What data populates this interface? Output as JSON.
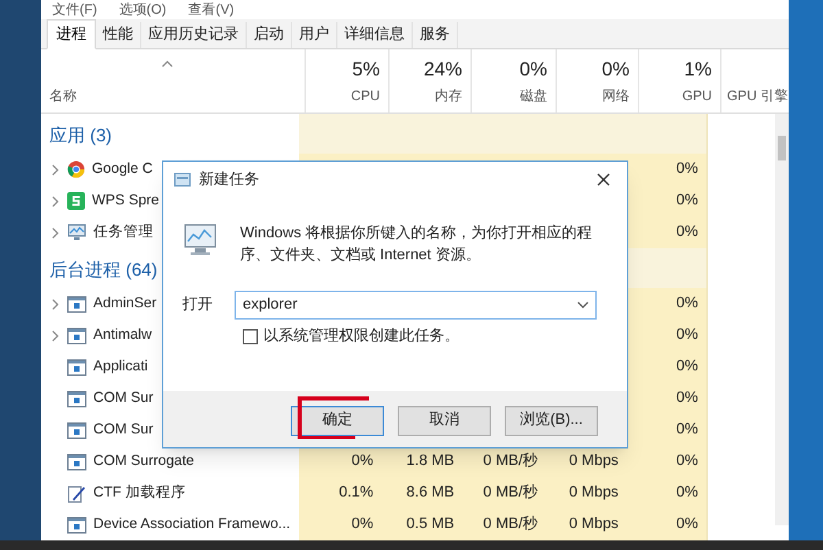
{
  "menu": [
    "文件(F)",
    "选项(O)",
    "查看(V)"
  ],
  "tabs": [
    {
      "label": "进程",
      "selected": true
    },
    {
      "label": "性能",
      "selected": false
    },
    {
      "label": "应用历史记录",
      "selected": false
    },
    {
      "label": "启动",
      "selected": false
    },
    {
      "label": "用户",
      "selected": false
    },
    {
      "label": "详细信息",
      "selected": false
    },
    {
      "label": "服务",
      "selected": false
    }
  ],
  "columns": [
    {
      "label": "名称"
    },
    {
      "value": "5%",
      "label": "CPU"
    },
    {
      "value": "24%",
      "label": "内存"
    },
    {
      "value": "0%",
      "label": "磁盘"
    },
    {
      "value": "0%",
      "label": "网络"
    },
    {
      "value": "1%",
      "label": "GPU"
    },
    {
      "label": "GPU 引擎"
    }
  ],
  "rows": [
    {
      "kind": "group",
      "name": "应用 (3)"
    },
    {
      "kind": "process",
      "expandable": true,
      "name": "Google C",
      "cells": [
        "",
        "",
        "",
        "",
        "0%"
      ]
    },
    {
      "kind": "process",
      "expandable": true,
      "name": "WPS Spre",
      "cells": [
        "",
        "",
        "",
        "",
        "0%"
      ]
    },
    {
      "kind": "process",
      "expandable": true,
      "name": "任务管理",
      "cells": [
        "",
        "",
        "",
        "",
        "0%"
      ]
    },
    {
      "kind": "group",
      "name": "后台进程 (64)"
    },
    {
      "kind": "process",
      "expandable": true,
      "name": "AdminSer",
      "cells": [
        "",
        "",
        "",
        "",
        "0%"
      ]
    },
    {
      "kind": "process",
      "expandable": true,
      "name": "Antimalw",
      "cells": [
        "",
        "",
        "",
        "",
        "0%"
      ]
    },
    {
      "kind": "process",
      "expandable": false,
      "name": "Applicati",
      "cells": [
        "",
        "",
        "",
        "",
        "0%"
      ]
    },
    {
      "kind": "process",
      "expandable": false,
      "name": "COM Sur",
      "cells": [
        "",
        "",
        "",
        "",
        "0%"
      ]
    },
    {
      "kind": "process",
      "expandable": false,
      "name": "COM Sur",
      "cells": [
        "",
        "",
        "",
        "",
        "0%"
      ]
    },
    {
      "kind": "process",
      "expandable": false,
      "name": "COM Surrogate",
      "cells": [
        "0%",
        "1.8 MB",
        "0 MB/秒",
        "0 Mbps",
        "0%"
      ]
    },
    {
      "kind": "process",
      "expandable": false,
      "name": "CTF 加载程序",
      "cells": [
        "0.1%",
        "8.6 MB",
        "0 MB/秒",
        "0 Mbps",
        "0%"
      ]
    },
    {
      "kind": "process",
      "expandable": false,
      "name": "Device Association Framewo...",
      "cells": [
        "0%",
        "0.5 MB",
        "0 MB/秒",
        "0 Mbps",
        "0%"
      ]
    }
  ],
  "dialog": {
    "title": "新建任务",
    "message": "Windows 将根据你所键入的名称，为你打开相应的程序、文件夹、文档或 Internet 资源。",
    "open_label": "打开",
    "open_value": "explorer",
    "admin_checkbox": {
      "label": "以系统管理权限创建此任务。",
      "checked": false
    },
    "buttons": [
      "确定",
      "取消",
      "浏览(B)..."
    ]
  }
}
